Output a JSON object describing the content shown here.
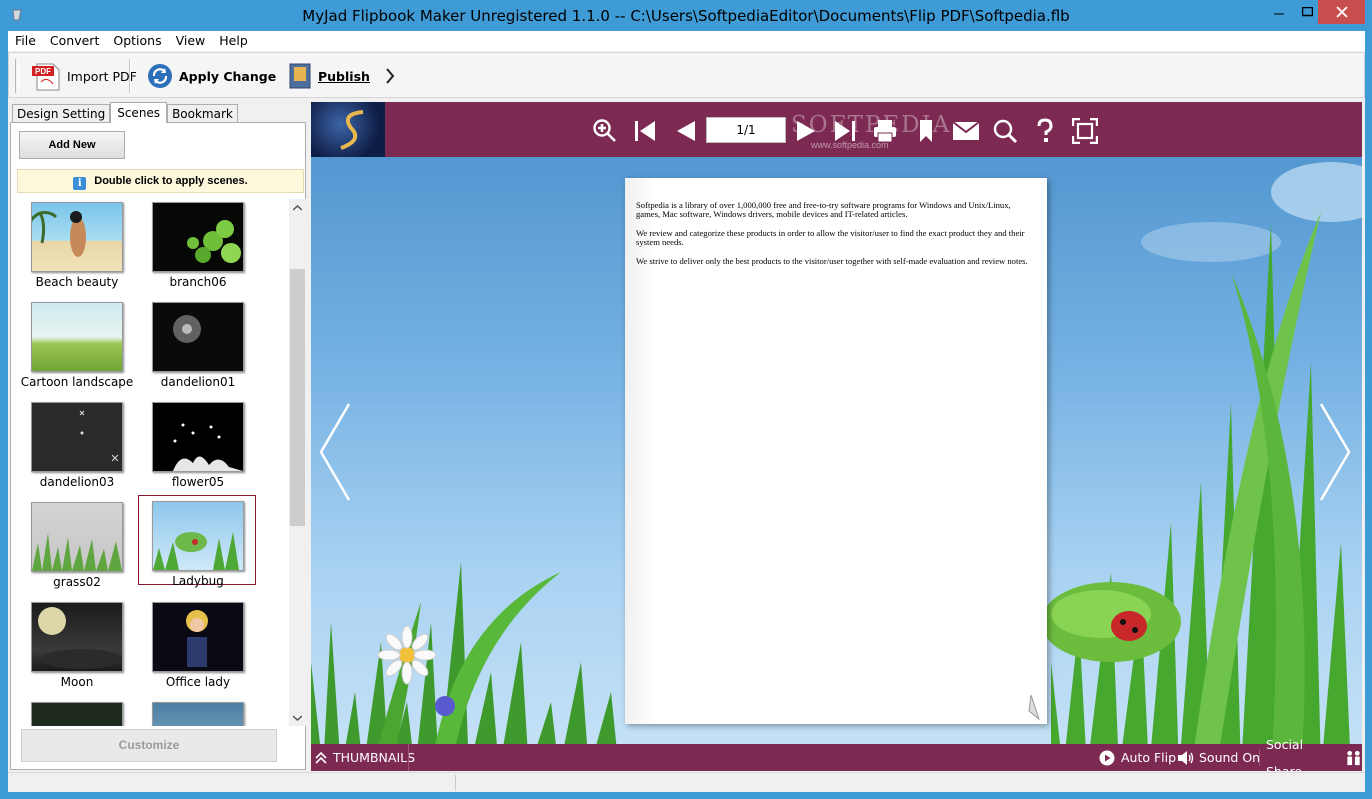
{
  "window": {
    "title": "MyJad Flipbook Maker Unregistered 1.1.0  -- C:\\Users\\SoftpediaEditor\\Documents\\Flip PDF\\Softpedia.flb"
  },
  "menu": [
    "File",
    "Convert",
    "Options",
    "View",
    "Help"
  ],
  "toolbar": {
    "import_pdf": "Import PDF",
    "apply_change": "Apply Change",
    "publish": "Publish",
    "pdf_badge": "PDF"
  },
  "tabs": [
    "Design Setting",
    "Scenes",
    "Bookmark"
  ],
  "active_tab": "Scenes",
  "scenes_panel": {
    "add_new": "Add New",
    "hint": "Double click to apply scenes.",
    "customize": "Customize",
    "scenes": [
      {
        "name": "Beach beauty"
      },
      {
        "name": "branch06"
      },
      {
        "name": "Cartoon landscape"
      },
      {
        "name": "dandelion01"
      },
      {
        "name": "dandelion03"
      },
      {
        "name": "flower05"
      },
      {
        "name": "grass02"
      },
      {
        "name": "Ladybug",
        "selected": true
      },
      {
        "name": "Moon"
      },
      {
        "name": "Office lady"
      }
    ]
  },
  "flipbook": {
    "page_counter": "1/1",
    "watermark": "SOFTPEDIA",
    "watermark_sub": "www.softpedia.com",
    "page_text": [
      "Softpedia is a library of over 1,000,000 free and free-to-try software programs for Windows and Unix/Linux, games, Mac software, Windows drivers, mobile devices and IT-related articles.",
      "We review and categorize these products in order to allow the visitor/user to find the exact product they and their system needs.",
      "We strive to deliver only the best products to the visitor/user together with self-made evaluation and review notes."
    ],
    "bottom": {
      "thumbnails": "THUMBNAILS",
      "auto_flip": "Auto Flip",
      "sound_on": "Sound On",
      "social_share": "Social Share"
    },
    "colors": {
      "bar": "#7d2a53",
      "sky": "#76b2e3"
    }
  }
}
